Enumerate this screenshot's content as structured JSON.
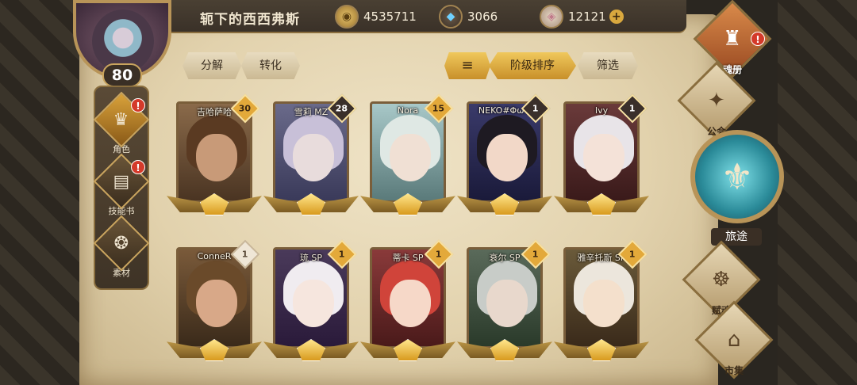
{
  "player": {
    "name": "轭下的西西弗斯",
    "level": "80"
  },
  "currencies": [
    {
      "name": "gold",
      "icon": "coin-icon",
      "value": "4535711"
    },
    {
      "name": "gem",
      "icon": "gem-icon",
      "value": "3066"
    },
    {
      "name": "crystal",
      "icon": "crystal-icon",
      "value": "12121"
    }
  ],
  "left_nav": [
    {
      "label": "角色",
      "icon": "character-icon",
      "alert": "!",
      "active": true
    },
    {
      "label": "技能书",
      "icon": "skillbook-icon",
      "alert": "!",
      "active": false
    },
    {
      "label": "素材",
      "icon": "material-icon",
      "alert": "",
      "active": false
    }
  ],
  "toolbar": {
    "decompose": "分解",
    "convert": "转化",
    "sort_order": "阶级排序",
    "filter": "筛选"
  },
  "cards": [
    {
      "name": "吉哈萨哈",
      "count": "30",
      "badge": "gold"
    },
    {
      "name": "雪莉 MZ",
      "count": "28",
      "badge": "dark"
    },
    {
      "name": "Nora",
      "count": "15",
      "badge": "gold"
    },
    {
      "name": "NEKO#ΦωΦ",
      "count": "1",
      "badge": "dark"
    },
    {
      "name": "Ivy",
      "count": "1",
      "badge": "dark"
    },
    {
      "name": "ConneR",
      "count": "1",
      "badge": "light"
    },
    {
      "name": "琉 SP",
      "count": "1",
      "badge": "gold"
    },
    {
      "name": "蒂卡 SP",
      "count": "1",
      "badge": "gold"
    },
    {
      "name": "衰尔 SP",
      "count": "1",
      "badge": "gold"
    },
    {
      "name": "雅辛托斯 SP",
      "count": "1",
      "badge": "gold"
    }
  ],
  "right_nav": [
    {
      "label": "魂册",
      "icon": "soul-book-icon",
      "alert": "!"
    },
    {
      "label": "公会",
      "icon": "guild-icon"
    },
    {
      "label": "旅途",
      "icon": "journey-icon"
    },
    {
      "label": "赋魂",
      "icon": "soul-infuse-icon"
    },
    {
      "label": "市集",
      "icon": "market-icon"
    }
  ],
  "colors": {
    "accent_gold": "#e3a93a",
    "parchment": "#e8dcc0",
    "frame_dark": "#3a2f25",
    "alert_red": "#d43a2a",
    "journey_teal": "#2a8a98"
  }
}
